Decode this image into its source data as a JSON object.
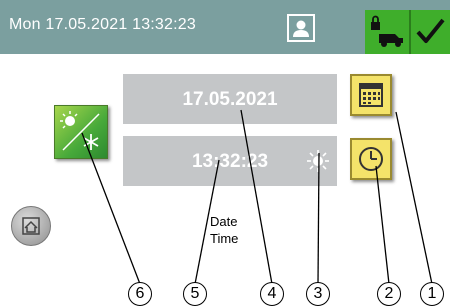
{
  "status_bar": {
    "datetime": "Mon 17.05.2021  13:32:23",
    "icons": [
      "user-icon",
      "lock-vehicle-icon",
      "checkmark-icon"
    ]
  },
  "date_field": {
    "value": "17.05.2021"
  },
  "time_field": {
    "value": "13:32:23",
    "icon": "sun-icon"
  },
  "buttons": {
    "calendar": "calendar-icon",
    "clock": "clock-icon",
    "summer_winter": "sun-snowflake-icon",
    "home": "home-icon"
  },
  "labels": {
    "date": "Date",
    "time": "Time"
  },
  "callouts": [
    "1",
    "2",
    "3",
    "4",
    "5",
    "6"
  ],
  "colors": {
    "status_bar": "#7b9f9f",
    "status_ok": "#3fae2b",
    "field_bg": "#c4c6c8",
    "button_yellow": "#f4e36a",
    "button_green": "#47a93a"
  }
}
